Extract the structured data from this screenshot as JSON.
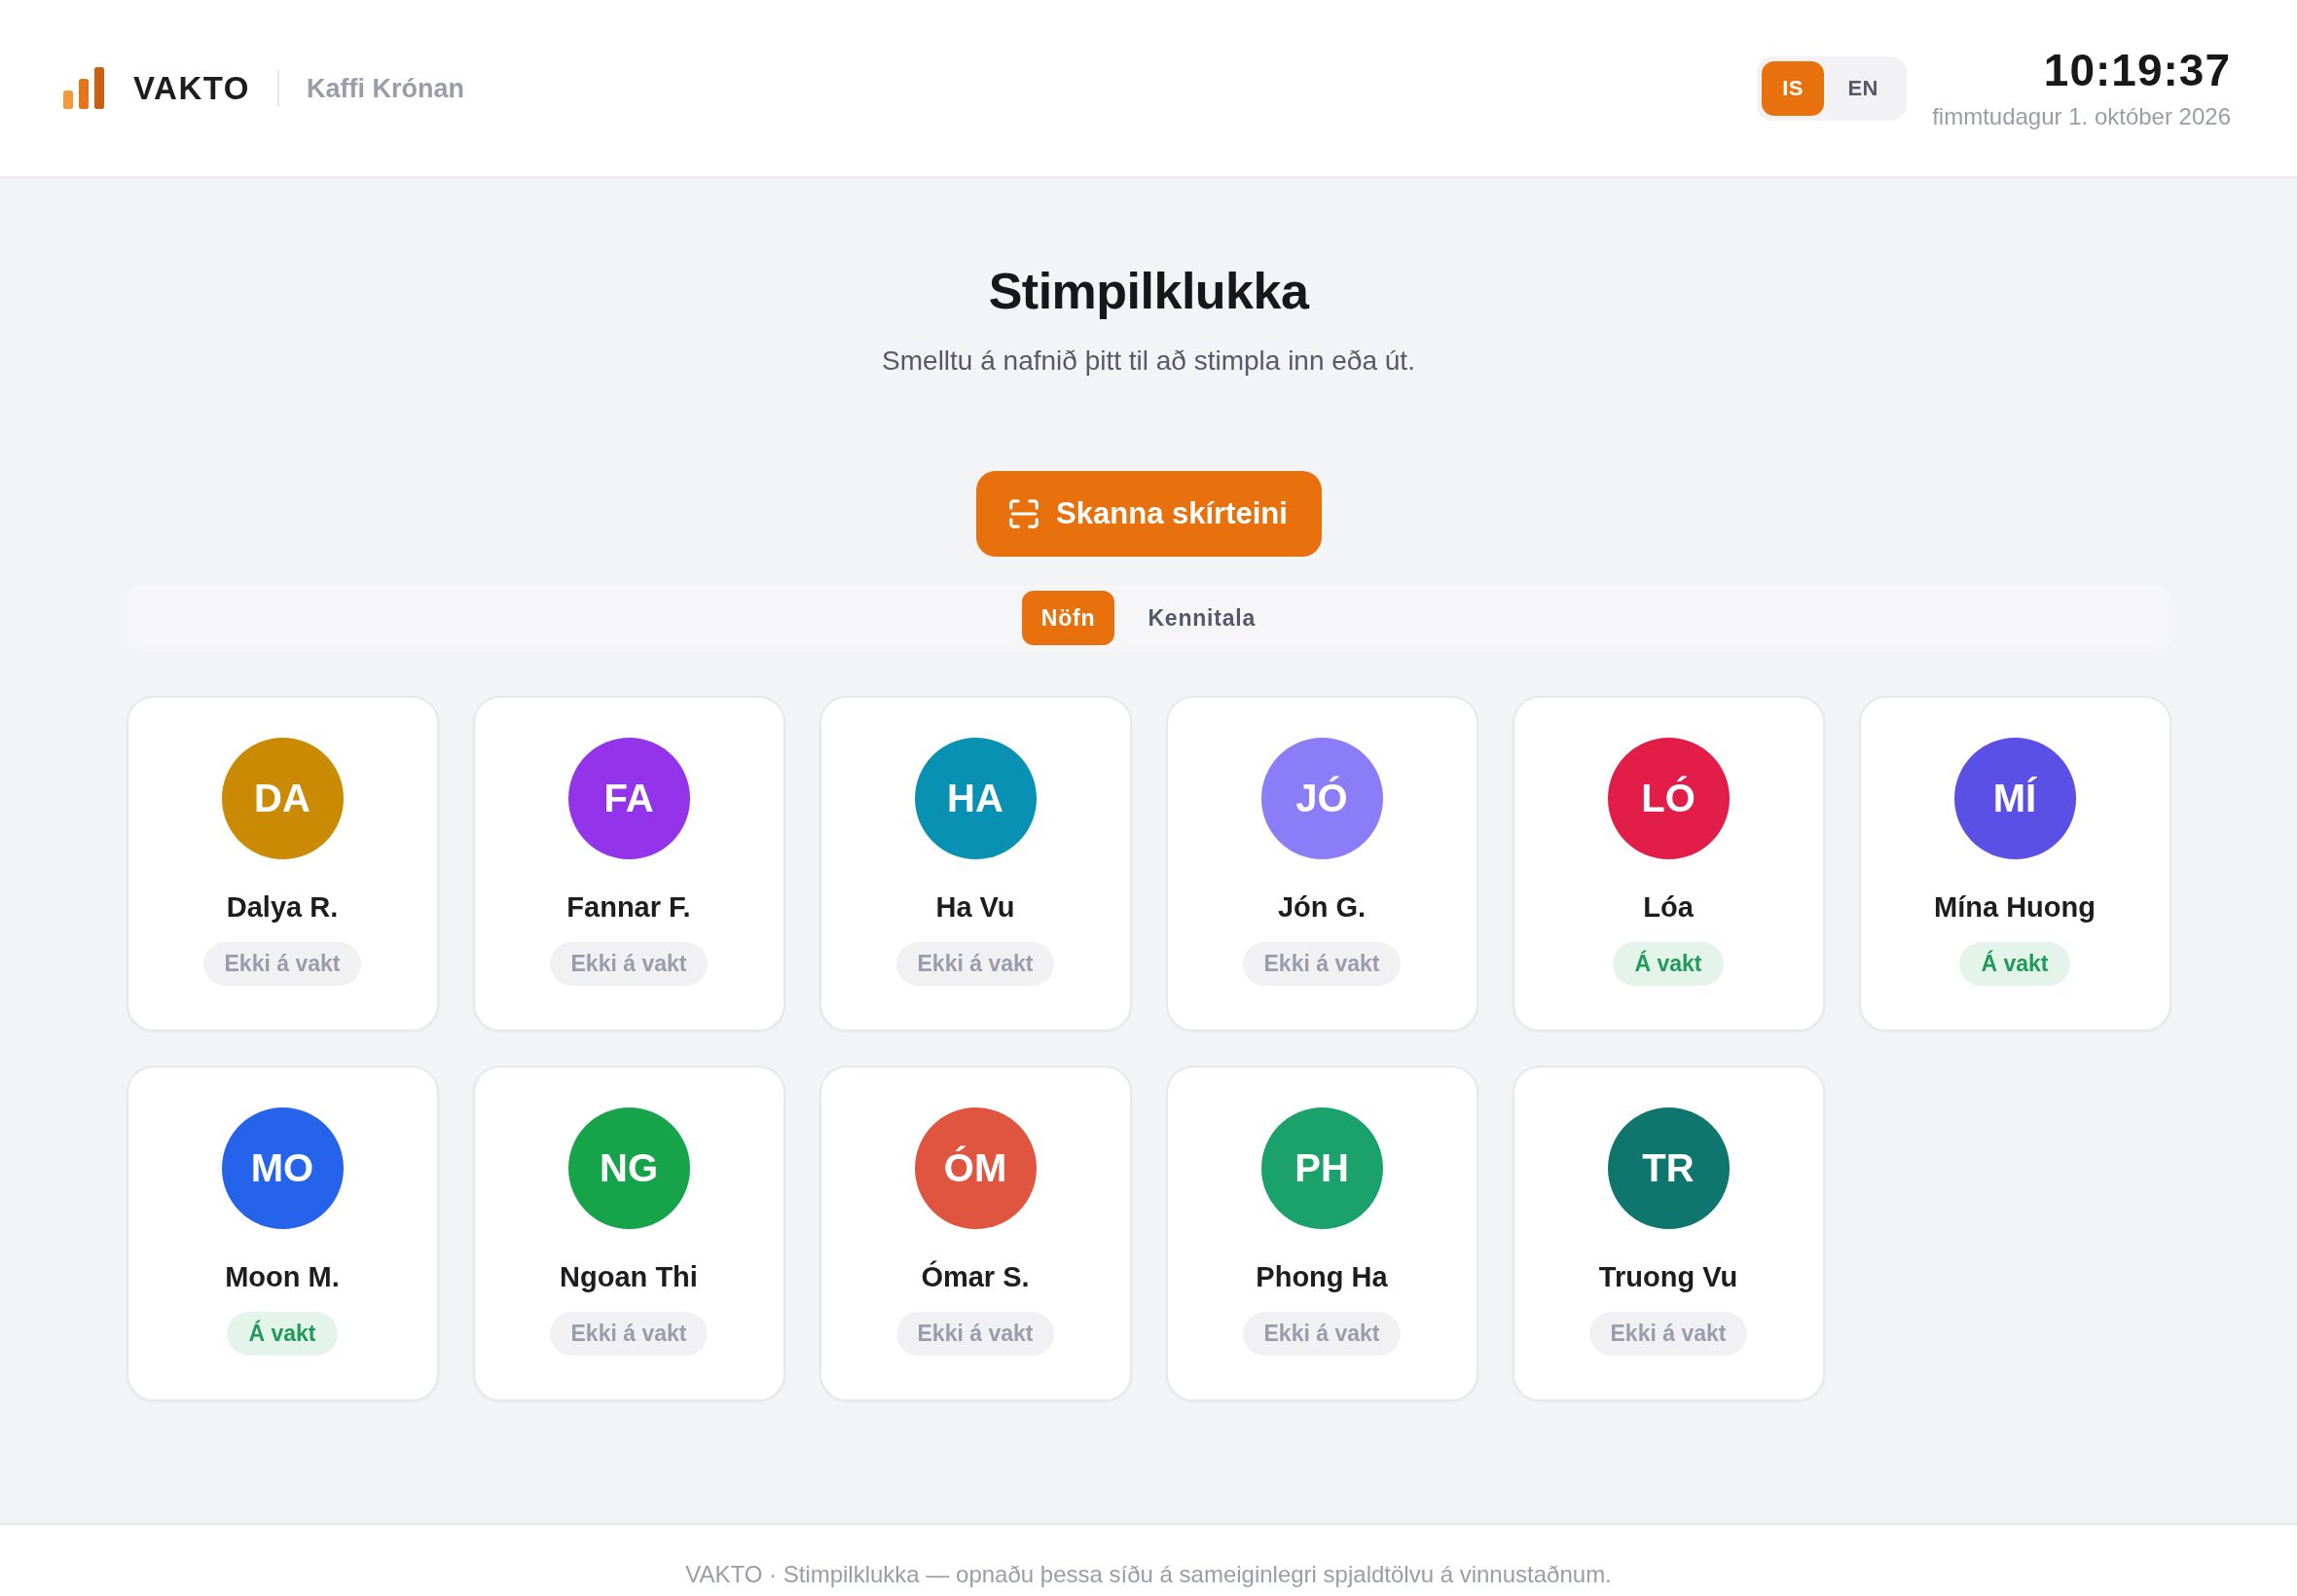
{
  "header": {
    "brand": "VAKTO",
    "workplace": "Kaffi Krónan",
    "languages": [
      {
        "label": "IS",
        "selected": true
      },
      {
        "label": "EN",
        "selected": false
      }
    ],
    "clock": {
      "time": "10:19:37",
      "date": "fimmtudagur 1. október 2026"
    }
  },
  "main": {
    "title": "Stimpilklukka",
    "subtitle": "Smelltu á nafnið þitt til að stimpla inn eða út.",
    "scan_button": {
      "label": "Skanna skírteini"
    },
    "view_tabs": [
      {
        "label": "Nöfn",
        "selected": true
      },
      {
        "label": "Kennitala",
        "selected": false
      }
    ],
    "employees": [
      {
        "initials": "DA",
        "name": "Dalya R.",
        "color": "#ca8a04",
        "on_shift": false,
        "status": "Ekki á vakt"
      },
      {
        "initials": "FA",
        "name": "Fannar F.",
        "color": "#9333ea",
        "on_shift": false,
        "status": "Ekki á vakt"
      },
      {
        "initials": "HA",
        "name": "Ha Vu",
        "color": "#0891b2",
        "on_shift": false,
        "status": "Ekki á vakt"
      },
      {
        "initials": "JÓ",
        "name": "Jón G.",
        "color": "#8b7cf8",
        "on_shift": false,
        "status": "Ekki á vakt"
      },
      {
        "initials": "LÓ",
        "name": "Lóa",
        "color": "#e11d48",
        "on_shift": true,
        "status": "Á vakt"
      },
      {
        "initials": "MÍ",
        "name": "Mína Huong",
        "color": "#5b50e5",
        "on_shift": true,
        "status": "Á vakt"
      },
      {
        "initials": "MO",
        "name": "Moon M.",
        "color": "#2563eb",
        "on_shift": true,
        "status": "Á vakt"
      },
      {
        "initials": "NG",
        "name": "Ngoan Thi",
        "color": "#16a34a",
        "on_shift": false,
        "status": "Ekki á vakt"
      },
      {
        "initials": "ÓM",
        "name": "Ómar S.",
        "color": "#e0553f",
        "on_shift": false,
        "status": "Ekki á vakt"
      },
      {
        "initials": "PH",
        "name": "Phong Ha",
        "color": "#1ba26c",
        "on_shift": false,
        "status": "Ekki á vakt"
      },
      {
        "initials": "TR",
        "name": "Truong Vu",
        "color": "#0f766e",
        "on_shift": false,
        "status": "Ekki á vakt"
      }
    ]
  },
  "footer": {
    "text": "VAKTO · Stimpilklukka — opnaðu þessa síðu á sameiginlegri spjaldtölvu á vinnustaðnum."
  }
}
